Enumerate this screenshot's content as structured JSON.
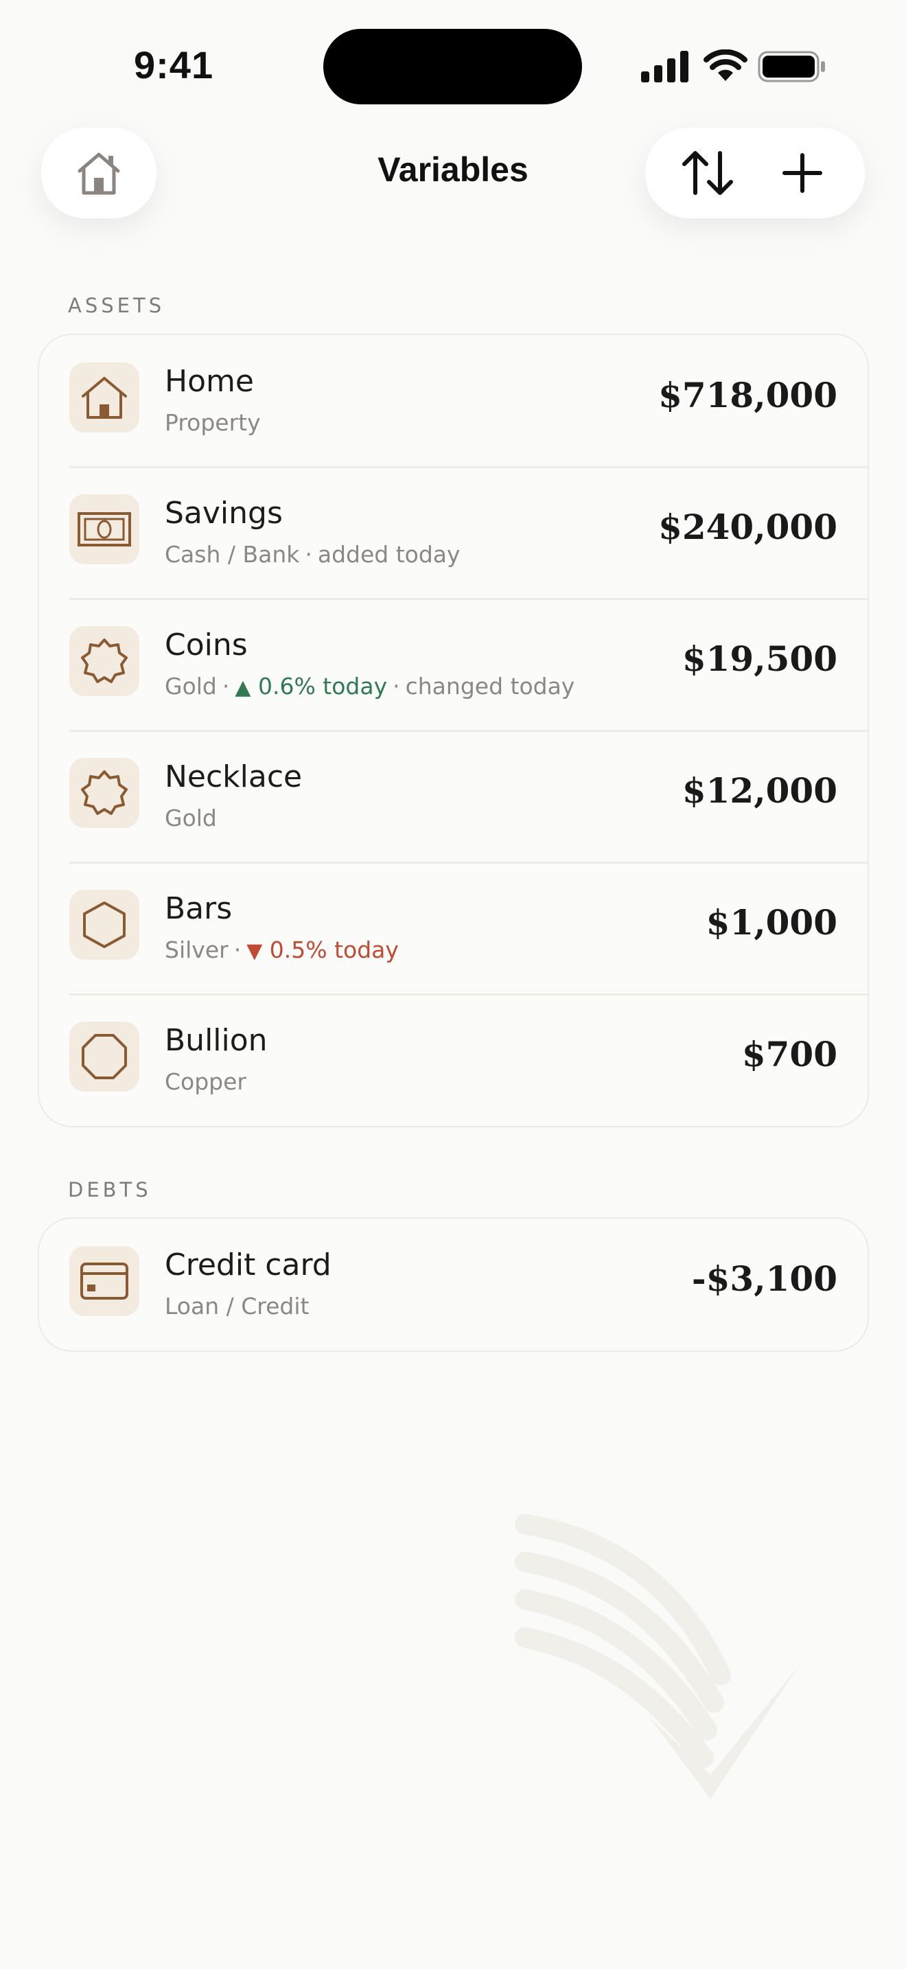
{
  "status_bar": {
    "time": "9:41"
  },
  "header": {
    "title": "Variables",
    "home_icon": "home-icon",
    "sort_icon": "sort-arrows-icon",
    "add_icon": "plus-icon"
  },
  "assets": {
    "label": "ASSETS",
    "items": [
      {
        "name": "Home",
        "category": "Property",
        "value": "$718,000",
        "icon": "house-icon"
      },
      {
        "name": "Savings",
        "category": "Cash / Bank",
        "note": "added today",
        "value": "$240,000",
        "icon": "banknote-icon"
      },
      {
        "name": "Coins",
        "category": "Gold",
        "change": "0.6% today",
        "note": "changed today",
        "value": "$19,500",
        "icon": "badge-icon"
      },
      {
        "name": "Necklace",
        "category": "Gold",
        "value": "$12,000",
        "icon": "badge-icon"
      },
      {
        "name": "Bars",
        "category": "Silver",
        "change": "0.5% today",
        "value": "$1,000",
        "icon": "hexagon-icon"
      },
      {
        "name": "Bullion",
        "category": "Copper",
        "value": "$700",
        "icon": "octagon-icon"
      }
    ]
  },
  "debts": {
    "label": "DEBTS",
    "items": [
      {
        "name": "Credit card",
        "category": "Loan / Credit",
        "value": "-$3,100",
        "icon": "credit-card-icon"
      }
    ]
  },
  "colors": {
    "background": "#fafaf9",
    "accent_brown": "#8a5a33",
    "tile_bg": "#f3ebe0",
    "positive": "#2f7a52",
    "negative": "#c04a32"
  }
}
